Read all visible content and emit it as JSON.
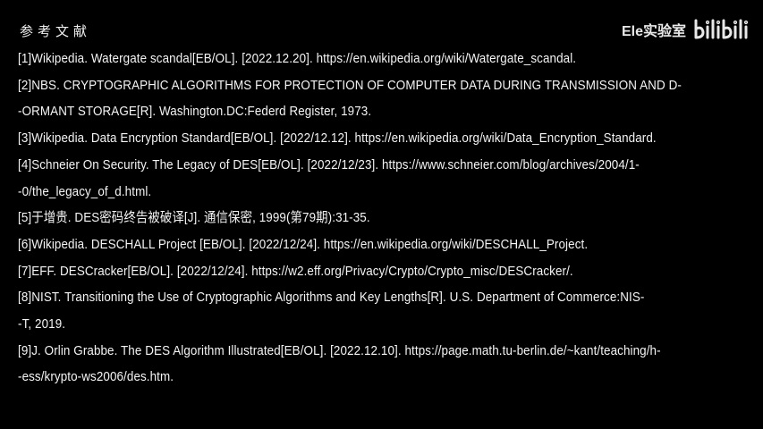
{
  "title": "参考文献",
  "watermark": {
    "text": "Ele实验室",
    "logo": "bilibili"
  },
  "references": [
    [
      "[1]Wikipedia. Watergate scandal[EB/OL]. [2022.12.20]. https://en.wikipedia.org/wiki/Watergate_scandal."
    ],
    [
      "[2]NBS. CRYPTOGRAPHIC ALGORITHMS FOR PROTECTION OF COMPUTER DATA DURING TRANSMISSION AND D-",
      "-ORMANT STORAGE[R]. Washington.DC:Federd Register, 1973."
    ],
    [
      "[3]Wikipedia. Data Encryption Standard[EB/OL]. [2022/12.12]. https://en.wikipedia.org/wiki/Data_Encryption_Standard."
    ],
    [
      "[4]Schneier On Security. The Legacy of DES[EB/OL]. [2022/12/23]. https://www.schneier.com/blog/archives/2004/1-",
      "-0/the_legacy_of_d.html."
    ],
    [
      "[5]于增贵. DES密码终告被破译[J]. 通信保密, 1999(第79期):31-35."
    ],
    [
      "[6]Wikipedia. DESCHALL Project [EB/OL]. [2022/12/24]. https://en.wikipedia.org/wiki/DESCHALL_Project."
    ],
    [
      "[7]EFF. DESCracker[EB/OL]. [2022/12/24]. https://w2.eff.org/Privacy/Crypto/Crypto_misc/DESCracker/."
    ],
    [
      "[8]NIST. Transitioning the Use of Cryptographic Algorithms and Key Lengths[R]. U.S. Department of Commerce:NIS-",
      "-T, 2019."
    ],
    [
      "[9]J. Orlin Grabbe. The DES Algorithm Illustrated[EB/OL]. [2022.12.10]. https://page.math.tu-berlin.de/~kant/teaching/h-",
      "-ess/krypto-ws2006/des.htm."
    ]
  ]
}
